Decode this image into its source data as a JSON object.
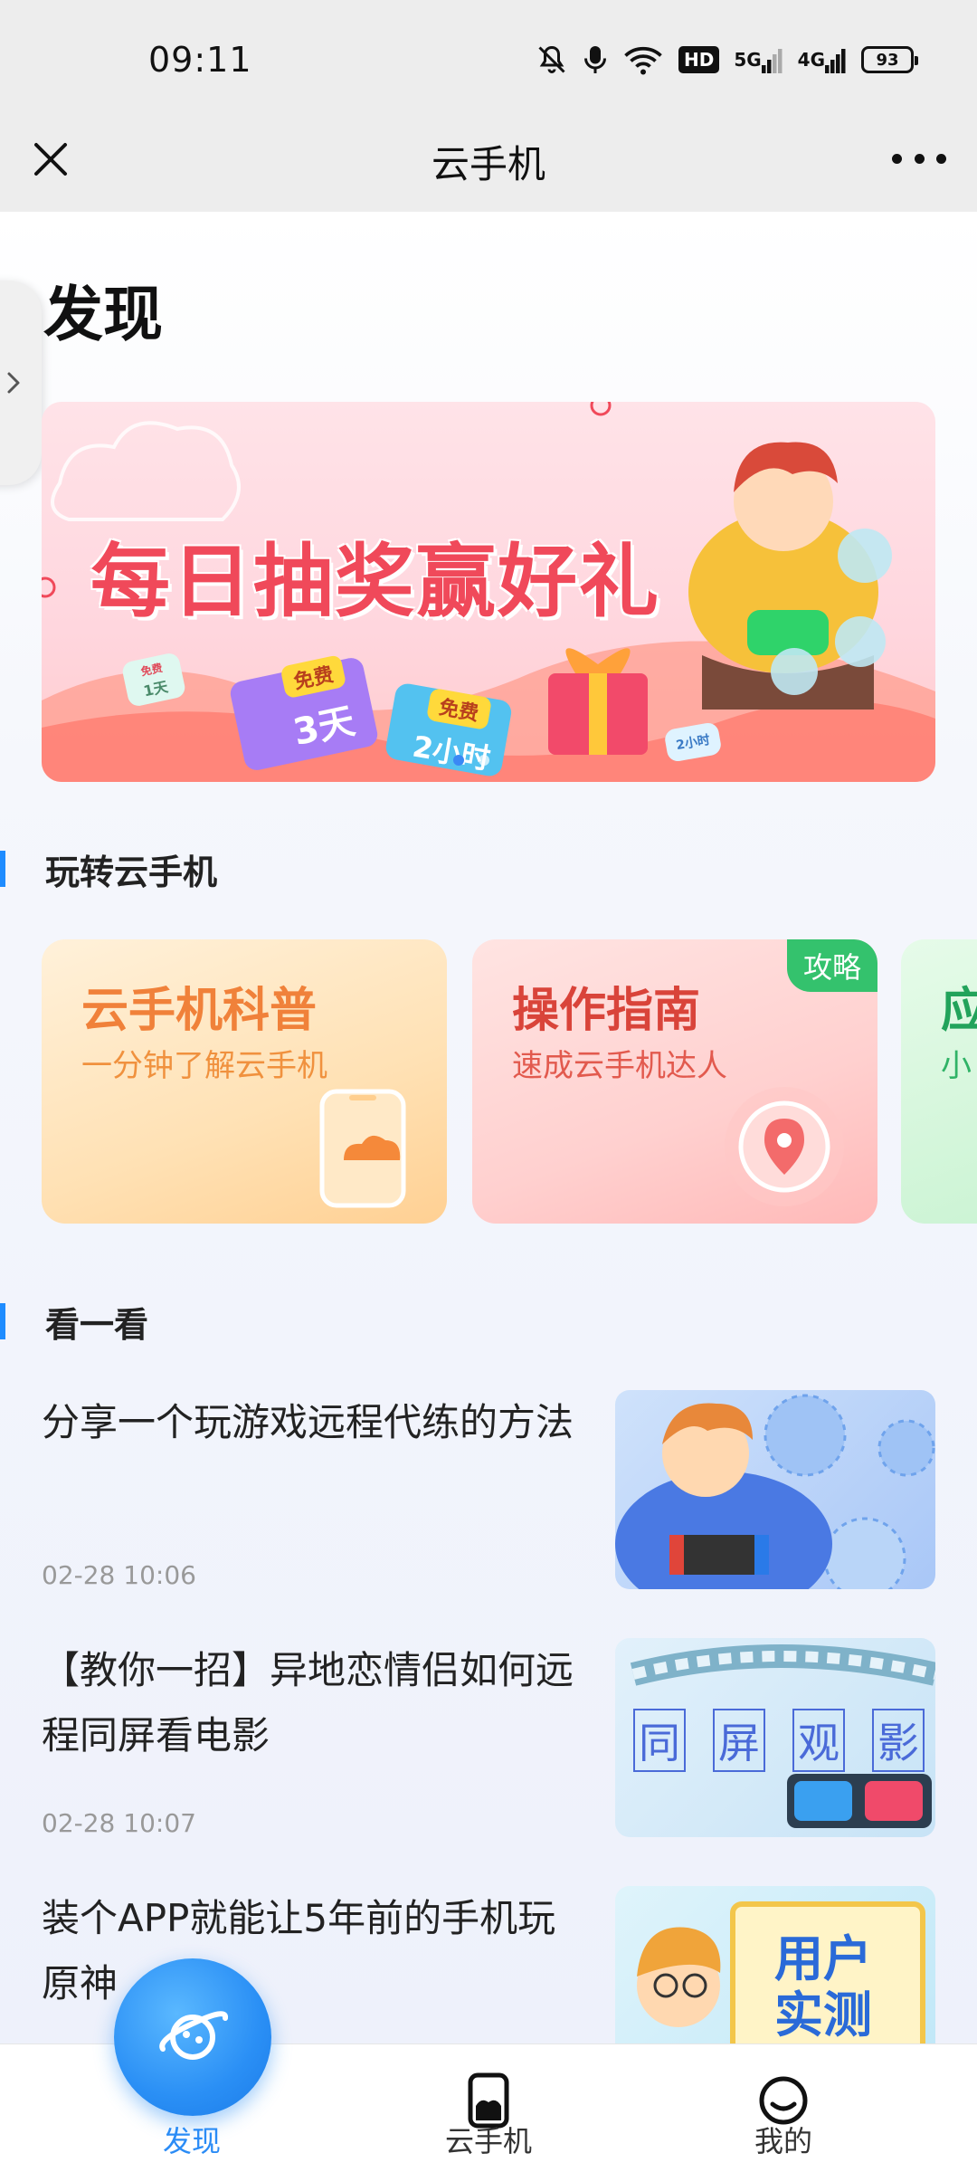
{
  "status_bar": {
    "time": "09:11",
    "hd_label": "HD",
    "net_5g": "5G",
    "net_4g": "4G",
    "battery": "93"
  },
  "nav": {
    "title": "云手机"
  },
  "page": {
    "title": "发现"
  },
  "banner": {
    "headline": "每日抽奖赢好礼",
    "ticket1_tag": "免费",
    "ticket1_text": "3天",
    "ticket2_tag": "免费",
    "ticket2_text": "2小时",
    "small_ticket1_tag": "免费",
    "small_ticket1": "1天",
    "small_ticket2": "2小时"
  },
  "section_play": {
    "heading": "玩转云手机",
    "cards": [
      {
        "title": "云手机科普",
        "subtitle": "一分钟了解云手机"
      },
      {
        "title": "操作指南",
        "subtitle": "速成云手机达人",
        "badge": "攻略"
      },
      {
        "title": "应",
        "subtitle": "小"
      }
    ]
  },
  "section_watch": {
    "heading": "看一看",
    "articles": [
      {
        "title": "分享一个玩游戏远程代练的方法",
        "date": "02-28 10:06"
      },
      {
        "title": "【教你一招】异地恋情侣如何远程同屏看电影",
        "date": "02-28 10:07",
        "thumb_text": [
          "同",
          "屏",
          "观",
          "影"
        ]
      },
      {
        "title": "装个APP就能让5年前的手机玩原神",
        "date": "",
        "thumb_text": [
          "用户",
          "实测"
        ]
      }
    ]
  },
  "bottom_nav": {
    "items": [
      {
        "label": "发现"
      },
      {
        "label": "云手机"
      },
      {
        "label": "我的"
      }
    ]
  },
  "colors": {
    "accent": "#2b8cf6",
    "banner_text": "#f0495a",
    "card1": "#f0813a",
    "card2": "#d9443a",
    "card3": "#22a35b"
  }
}
